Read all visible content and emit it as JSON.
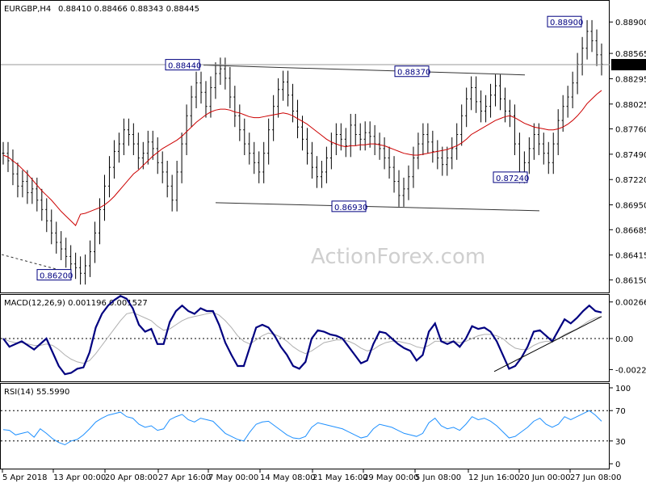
{
  "chart_data": [
    {
      "type": "line",
      "title": "EURGBP,H4",
      "ohlc": "0.88410 0.88466 0.88343 0.88445",
      "ylim": [
        0.8605,
        0.891
      ],
      "y_ticks": [
        "0.88900",
        "0.88565",
        "0.88295",
        "0.88025",
        "0.87760",
        "0.87490",
        "0.87220",
        "0.86950",
        "0.86685",
        "0.86415",
        "0.86150"
      ],
      "current_price": "0.88445",
      "x_ticks": [
        "5 Apr 2018",
        "13 Apr 00:00",
        "20 Apr 08:00",
        "27 Apr 16:00",
        "7 May 00:00",
        "14 May 08:00",
        "21 May 16:00",
        "29 May 00:00",
        "5 Jun 08:00",
        "12 Jun 16:00",
        "20 Jun 00:00",
        "27 Jun 08:00"
      ],
      "watermark": "ActionForex.com",
      "annotations": [
        {
          "label": "0.88900",
          "value": 0.889
        },
        {
          "label": "0.88440",
          "value": 0.8844
        },
        {
          "label": "0.88370",
          "value": 0.8837
        },
        {
          "label": "0.87240",
          "value": 0.8724
        },
        {
          "label": "0.86930",
          "value": 0.8693
        },
        {
          "label": "0.86200",
          "value": 0.862
        }
      ],
      "close": [
        0.875,
        0.8742,
        0.8728,
        0.8715,
        0.872,
        0.8708,
        0.8712,
        0.87,
        0.869,
        0.8678,
        0.8665,
        0.8655,
        0.8648,
        0.864,
        0.8632,
        0.8628,
        0.8622,
        0.863,
        0.8645,
        0.8665,
        0.869,
        0.8715,
        0.8735,
        0.8752,
        0.876,
        0.8775,
        0.877,
        0.876,
        0.8745,
        0.875,
        0.8762,
        0.8755,
        0.874,
        0.873,
        0.8715,
        0.87,
        0.873,
        0.876,
        0.879,
        0.881,
        0.8825,
        0.8815,
        0.88,
        0.882,
        0.8835,
        0.884,
        0.883,
        0.881,
        0.879,
        0.8775,
        0.876,
        0.875,
        0.874,
        0.873,
        0.875,
        0.8775,
        0.88,
        0.8818,
        0.8826,
        0.8812,
        0.8795,
        0.8778,
        0.8765,
        0.875,
        0.8735,
        0.8725,
        0.873,
        0.8745,
        0.876,
        0.877,
        0.8765,
        0.8758,
        0.878,
        0.877,
        0.8765,
        0.8772,
        0.8768,
        0.876,
        0.8755,
        0.8745,
        0.8735,
        0.872,
        0.8705,
        0.8712,
        0.8725,
        0.8745,
        0.876,
        0.877,
        0.8762,
        0.8752,
        0.8745,
        0.8738,
        0.8745,
        0.8755,
        0.877,
        0.879,
        0.8808,
        0.882,
        0.8805,
        0.8795,
        0.88,
        0.8812,
        0.8822,
        0.8808,
        0.8795,
        0.879,
        0.876,
        0.873,
        0.874,
        0.8755,
        0.877,
        0.876,
        0.875,
        0.874,
        0.876,
        0.8785,
        0.88,
        0.881,
        0.8825,
        0.8845,
        0.8862,
        0.888,
        0.887,
        0.8855,
        0.8845
      ],
      "ma": [
        0.8748,
        0.8746,
        0.8742,
        0.8738,
        0.8733,
        0.8728,
        0.8722,
        0.8716,
        0.871,
        0.8705,
        0.87,
        0.8694,
        0.8688,
        0.8683,
        0.8678,
        0.8673,
        0.8685,
        0.8686,
        0.8688,
        0.869,
        0.8692,
        0.8695,
        0.8699,
        0.8704,
        0.871,
        0.8716,
        0.8722,
        0.8728,
        0.8732,
        0.8737,
        0.8742,
        0.8747,
        0.8751,
        0.8755,
        0.8758,
        0.8761,
        0.8764,
        0.8768,
        0.8773,
        0.8778,
        0.8783,
        0.8787,
        0.8791,
        0.8794,
        0.8796,
        0.8797,
        0.8797,
        0.8796,
        0.8794,
        0.8793,
        0.8791,
        0.8789,
        0.8788,
        0.8788,
        0.8789,
        0.879,
        0.8791,
        0.8792,
        0.8793,
        0.8792,
        0.879,
        0.8787,
        0.8784,
        0.8781,
        0.8777,
        0.8773,
        0.8769,
        0.8765,
        0.8762,
        0.876,
        0.8758,
        0.8757,
        0.8758,
        0.8758,
        0.8759,
        0.8759,
        0.876,
        0.876,
        0.8759,
        0.8758,
        0.8756,
        0.8754,
        0.8752,
        0.875,
        0.8749,
        0.8748,
        0.8748,
        0.8749,
        0.875,
        0.8751,
        0.8752,
        0.8753,
        0.8754,
        0.8756,
        0.8758,
        0.8761,
        0.8765,
        0.877,
        0.8773,
        0.8776,
        0.8779,
        0.8782,
        0.8785,
        0.8787,
        0.8789,
        0.879,
        0.8788,
        0.8785,
        0.8782,
        0.878,
        0.8778,
        0.8777,
        0.8776,
        0.8775,
        0.8775,
        0.8776,
        0.8778,
        0.8781,
        0.8785,
        0.879,
        0.8796,
        0.8803,
        0.8808,
        0.8813,
        0.8817
      ]
    },
    {
      "type": "line",
      "title": "MACD(12,26,9) 0.001196 0.001527",
      "ylim": [
        -0.003,
        0.003
      ],
      "y_ticks": [
        "0.002663",
        "0.00",
        "-0.00226"
      ],
      "macd": [
        0.0,
        -0.0006,
        -0.0004,
        -0.0002,
        -0.0005,
        -0.0008,
        -0.0004,
        0.0,
        -0.001,
        -0.002,
        -0.0026,
        -0.0025,
        -0.0022,
        -0.0021,
        -0.001,
        0.0008,
        0.0018,
        0.0024,
        0.0028,
        0.0031,
        0.0029,
        0.0022,
        0.001,
        0.0005,
        0.0007,
        -0.0004,
        -0.0004,
        0.0012,
        0.002,
        0.0024,
        0.002,
        0.0018,
        0.0022,
        0.002,
        0.002,
        0.001,
        -0.0003,
        -0.0012,
        -0.002,
        -0.002,
        -0.0006,
        0.0008,
        0.001,
        0.0008,
        0.0002,
        -0.0006,
        -0.0012,
        -0.002,
        -0.0022,
        -0.0017,
        0.0,
        0.0006,
        0.0005,
        0.0003,
        0.0002,
        0.0,
        -0.0006,
        -0.0012,
        -0.0018,
        -0.0016,
        -0.0004,
        0.0005,
        0.0004,
        0.0,
        -0.0004,
        -0.0007,
        -0.0009,
        -0.0016,
        -0.0012,
        0.0005,
        0.0011,
        -0.0002,
        -0.0004,
        -0.0002,
        -0.0006,
        0.0,
        0.0009,
        0.0007,
        0.0008,
        0.0005,
        -0.0002,
        -0.0012,
        -0.0022,
        -0.002,
        -0.0014,
        -0.0006,
        0.0005,
        0.0006,
        0.0002,
        -0.0002,
        0.0006,
        0.0014,
        0.0011,
        0.0015,
        0.002,
        0.0024,
        0.002,
        0.0019
      ],
      "signal": [
        0.0,
        -0.0002,
        -0.0003,
        -0.0003,
        -0.0004,
        -0.0005,
        -0.0005,
        -0.0004,
        -0.0005,
        -0.0008,
        -0.0012,
        -0.0015,
        -0.0017,
        -0.0018,
        -0.0016,
        -0.0011,
        -0.0005,
        0.0001,
        0.0007,
        0.0013,
        0.0018,
        0.0019,
        0.0017,
        0.0015,
        0.0013,
        0.0009,
        0.0006,
        0.0007,
        0.001,
        0.0013,
        0.0015,
        0.0016,
        0.0017,
        0.0018,
        0.0019,
        0.0017,
        0.0013,
        0.0008,
        0.0002,
        -0.0002,
        -0.0004,
        -0.0001,
        0.0002,
        0.0004,
        0.0003,
        0.0001,
        -0.0002,
        -0.0006,
        -0.0009,
        -0.0011,
        -0.0009,
        -0.0006,
        -0.0003,
        -0.0002,
        -0.0001,
        -0.0001,
        -0.0002,
        -0.0004,
        -0.0007,
        -0.0009,
        -0.0008,
        -0.0005,
        -0.0003,
        -0.0002,
        -0.0002,
        -0.0003,
        -0.0004,
        -0.0006,
        -0.0007,
        -0.0005,
        -0.0002,
        -0.0002,
        -0.0002,
        -0.0002,
        -0.0003,
        -0.0002,
        0.0,
        0.0002,
        0.0003,
        0.0003,
        0.0002,
        0.0,
        -0.0004,
        -0.0007,
        -0.0008,
        -0.0008,
        -0.0005,
        -0.0003,
        -0.0002,
        -0.0002,
        0.0,
        0.0003,
        0.0005,
        0.0007,
        0.001,
        0.0013,
        0.0015,
        0.0016
      ]
    },
    {
      "type": "line",
      "title": "RSI(14) 55.5990",
      "ylim": [
        0,
        100
      ],
      "y_ticks": [
        "100",
        "70",
        "30",
        "0"
      ],
      "levels": [
        70,
        30
      ],
      "rsi": [
        45,
        44,
        38,
        40,
        42,
        35,
        46,
        40,
        33,
        28,
        25,
        30,
        32,
        38,
        46,
        55,
        60,
        64,
        66,
        68,
        62,
        60,
        52,
        48,
        50,
        44,
        46,
        58,
        62,
        65,
        58,
        55,
        60,
        58,
        56,
        48,
        40,
        36,
        32,
        30,
        42,
        52,
        55,
        56,
        50,
        44,
        38,
        34,
        33,
        36,
        48,
        54,
        52,
        50,
        48,
        46,
        42,
        38,
        34,
        36,
        46,
        52,
        50,
        48,
        44,
        40,
        38,
        36,
        40,
        54,
        60,
        50,
        46,
        48,
        44,
        52,
        62,
        58,
        60,
        56,
        50,
        42,
        34,
        36,
        42,
        48,
        56,
        60,
        52,
        48,
        52,
        62,
        58,
        62,
        66,
        70,
        64,
        56
      ]
    }
  ]
}
